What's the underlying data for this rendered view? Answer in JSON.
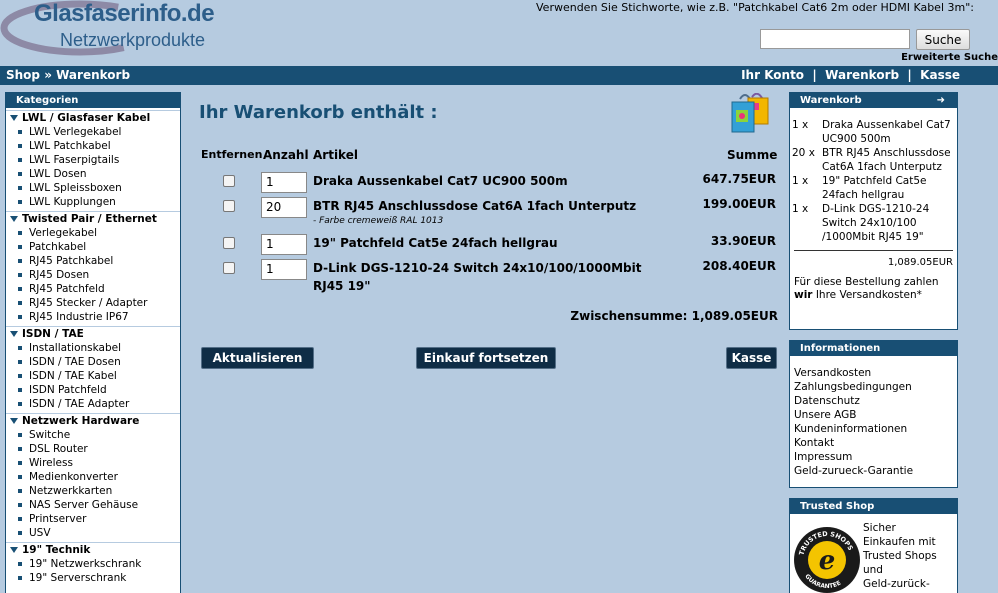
{
  "header": {
    "logo_line1": "Glasfaserinfo.de",
    "logo_line2": "Netzwerkprodukte",
    "hint": "Verwenden Sie Stichworte, wie z.B. \"Patchkabel Cat6 2m oder HDMI Kabel 3m\":",
    "search_value": "",
    "search_button": "Suche",
    "advanced_search": "Erweiterte Suche"
  },
  "nav": {
    "breadcrumb": "Shop » Warenkorb",
    "account": "Ihr Konto",
    "cart": "Warenkorb",
    "checkout": "Kasse",
    "sep": "  |  "
  },
  "sidebar": {
    "title": "Kategorien",
    "categories": [
      {
        "name": "LWL / Glasfaser Kabel",
        "items": [
          "LWL Verlegekabel",
          "LWL Patchkabel",
          "LWL Faserpigtails",
          "LWL Dosen",
          "LWL Spleissboxen",
          "LWL Kupplungen"
        ]
      },
      {
        "name": "Twisted Pair / Ethernet",
        "items": [
          "Verlegekabel",
          "Patchkabel",
          "RJ45 Patchkabel",
          "RJ45 Dosen",
          "RJ45 Patchfeld",
          "RJ45 Stecker / Adapter",
          "RJ45 Industrie IP67"
        ]
      },
      {
        "name": "ISDN / TAE",
        "items": [
          "Installationskabel",
          "ISDN / TAE Dosen",
          "ISDN / TAE Kabel",
          "ISDN Patchfeld",
          "ISDN / TAE Adapter"
        ]
      },
      {
        "name": "Netzwerk Hardware",
        "items": [
          "Switche",
          "DSL Router",
          "Wireless",
          "Medienkonverter",
          "Netzwerkkarten",
          "NAS Server Gehäuse",
          "Printserver",
          "USV"
        ]
      },
      {
        "name": "19\" Technik",
        "items": [
          "19\" Netzwerkschrank",
          "19\" Serverschrank"
        ]
      }
    ]
  },
  "cart": {
    "title": "Ihr Warenkorb enthält :",
    "headers": {
      "remove": "Entfernen",
      "qty": "Anzahl",
      "article": "Artikel",
      "sum": "Summe"
    },
    "rows": [
      {
        "qty": "1",
        "article": "Draka Aussenkabel Cat7 UC900 500m",
        "note": "",
        "sum": "647.75EUR"
      },
      {
        "qty": "20",
        "article": "BTR RJ45 Anschlussdose Cat6A 1fach Unterputz",
        "note": "- Farbe cremeweiß RAL 1013",
        "sum": "199.00EUR"
      },
      {
        "qty": "1",
        "article": "19\" Patchfeld Cat5e 24fach hellgrau",
        "note": "",
        "sum": "33.90EUR"
      },
      {
        "qty": "1",
        "article": "D-Link DGS-1210-24 Switch 24x10/100/1000Mbit RJ45 19\"",
        "note": "",
        "sum": "208.40EUR"
      }
    ],
    "subtotal": "Zwischensumme: 1,089.05EUR",
    "btn_update": "Aktualisieren",
    "btn_continue": "Einkauf fortsetzen",
    "btn_checkout": "Kasse"
  },
  "minicart": {
    "title": "Warenkorb",
    "items": [
      {
        "q": "1 x",
        "name": "Draka Aussenkabel Cat7 UC900 500m"
      },
      {
        "q": "20 x",
        "name": "BTR RJ45 Anschlussdose Cat6A 1fach Unterputz"
      },
      {
        "q": "1 x",
        "name": "19\" Patchfeld Cat5e 24fach hellgrau"
      },
      {
        "q": "1 x",
        "name": "D-Link DGS-1210-24 Switch 24x10/100 /1000Mbit RJ45 19\""
      }
    ],
    "total": "1,089.05EUR",
    "shipping_pre": "Für diese Bestellung zahlen ",
    "shipping_bold": "wir",
    "shipping_post": " Ihre Versandkosten*"
  },
  "info": {
    "title": "Informationen",
    "items": [
      "Versandkosten",
      "Zahlungsbedingungen",
      "Datenschutz",
      "Unsere AGB",
      "Kundeninformationen",
      "Kontakt",
      "Impressum",
      "Geld-zurueck-Garantie"
    ]
  },
  "trusted": {
    "title": "Trusted Shop",
    "lines": [
      "Sicher",
      "Einkaufen mit",
      "Trusted Shops",
      "und",
      "Geld-zurück-"
    ],
    "seal_top": "TRUSTED SHOPS",
    "seal_letter": "e",
    "seal_bottom": "GUARANTEE"
  }
}
